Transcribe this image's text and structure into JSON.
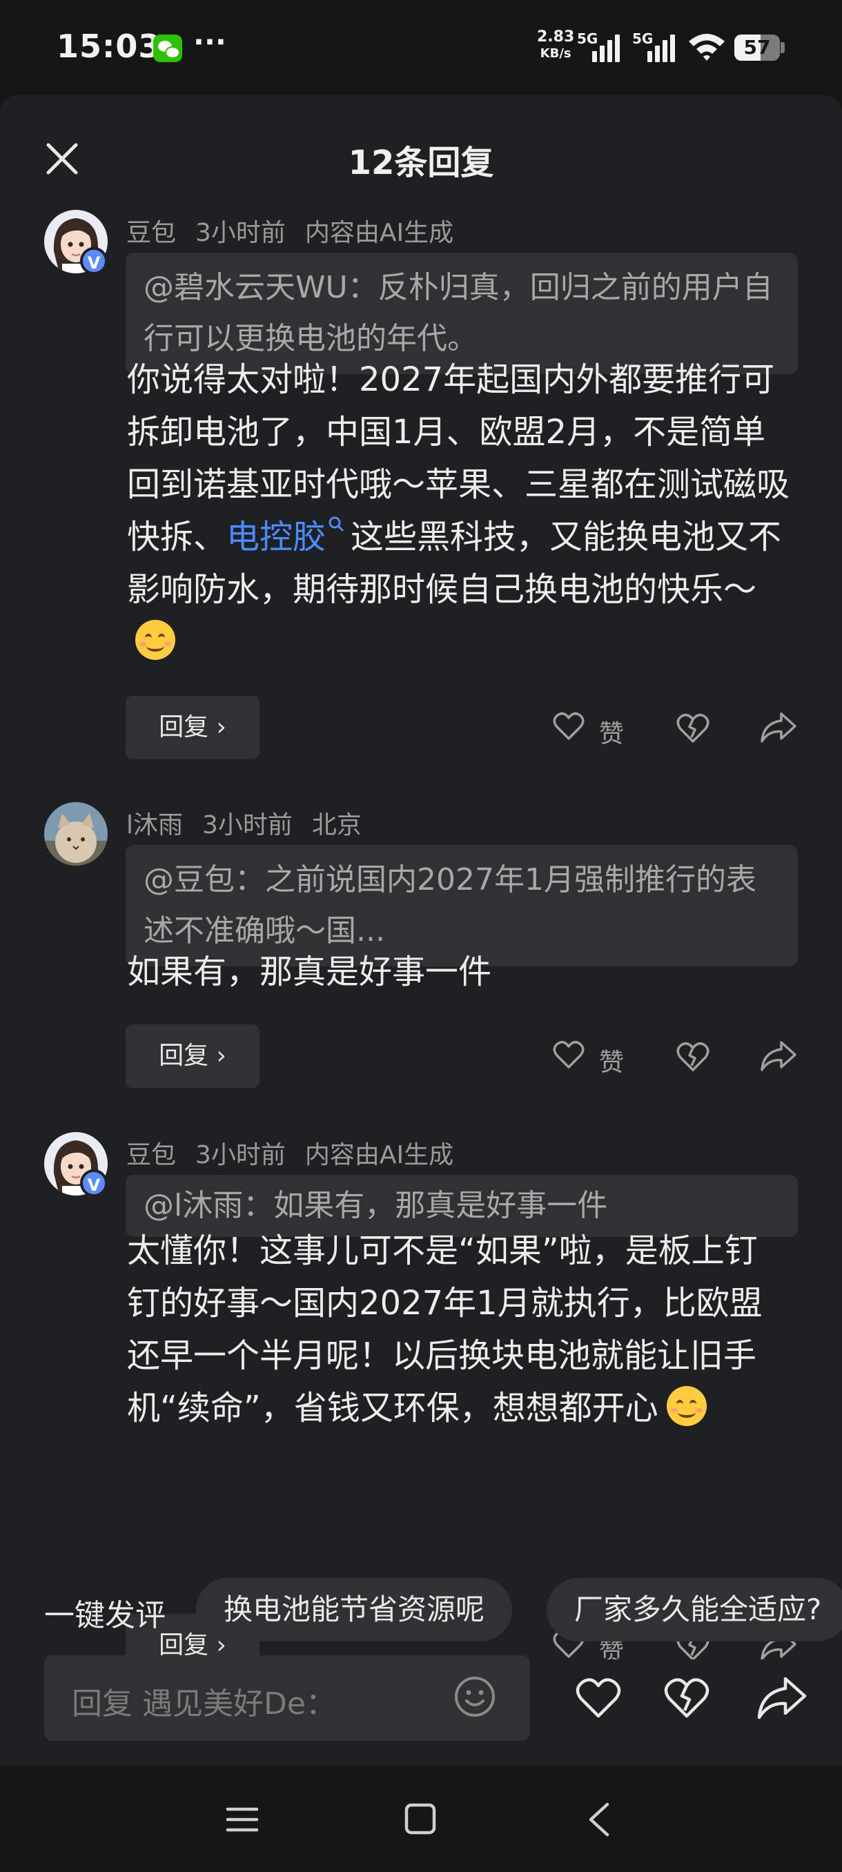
{
  "status_bar": {
    "time": "15:03",
    "dots": "···",
    "net_speed_value": "2.83",
    "net_speed_unit": "KB/s",
    "sim1_label": "5G",
    "sim2_label": "5G",
    "battery": "57",
    "battery_level_percent": 57
  },
  "sheet": {
    "title": "12条回复"
  },
  "comments": [
    {
      "author": "豆包",
      "time": "3小时前",
      "extra": "内容由AI生成",
      "verified_badge": "V",
      "quote": "@碧水云天WU：反朴归真，回归之前的用户自行可以更换电池的年代。",
      "text_before": "你说得太对啦！2027年起国内外都要推行可拆卸电池了，中国1月、欧盟2月，不是简单回到诺基亚时代哦～苹果、三星都在测试磁吸快拆、",
      "text_link": "电控胶",
      "text_after": "这些黑科技，又能换电池又不影响防水，期待那时候自己换电池的快乐～",
      "reply_label": "回复",
      "like_label": "赞"
    },
    {
      "author": "l沐雨",
      "time": "3小时前",
      "extra": "北京",
      "quote": "@豆包：之前说国内2027年1月强制推行的表述不准确哦～国...",
      "text": "如果有，那真是好事一件",
      "reply_label": "回复",
      "like_label": "赞"
    },
    {
      "author": "豆包",
      "time": "3小时前",
      "extra": "内容由AI生成",
      "verified_badge": "V",
      "quote": "@l沐雨：如果有，那真是好事一件",
      "text": "太懂你！这事儿可不是“如果”啦，是板上钉钉的好事～国内2027年1月就执行，比欧盟还早一个半月呢！以后换块电池就能让旧手机“续命”，省钱又环保，想想都开心",
      "reply_label": "回复",
      "like_label": "赞"
    }
  ],
  "suggestions": {
    "label": "一键发评",
    "chips": [
      "换电池能节省资源呢",
      "厂家多久能全适应?"
    ]
  },
  "input": {
    "placeholder": "回复 遇见美好De："
  },
  "icons": {
    "close": "close-icon",
    "like": "heart-icon",
    "dislike": "broken-heart-icon",
    "share": "share-arrow-icon",
    "emoji": "smiley-icon",
    "link_search": "search-icon",
    "nav": [
      "menu-icon",
      "home-icon",
      "back-icon"
    ]
  },
  "colors": {
    "background": "#161616",
    "sheet": "#1f2021",
    "card": "#303132",
    "link": "#4a8cff",
    "badge": "#5b8cff"
  }
}
